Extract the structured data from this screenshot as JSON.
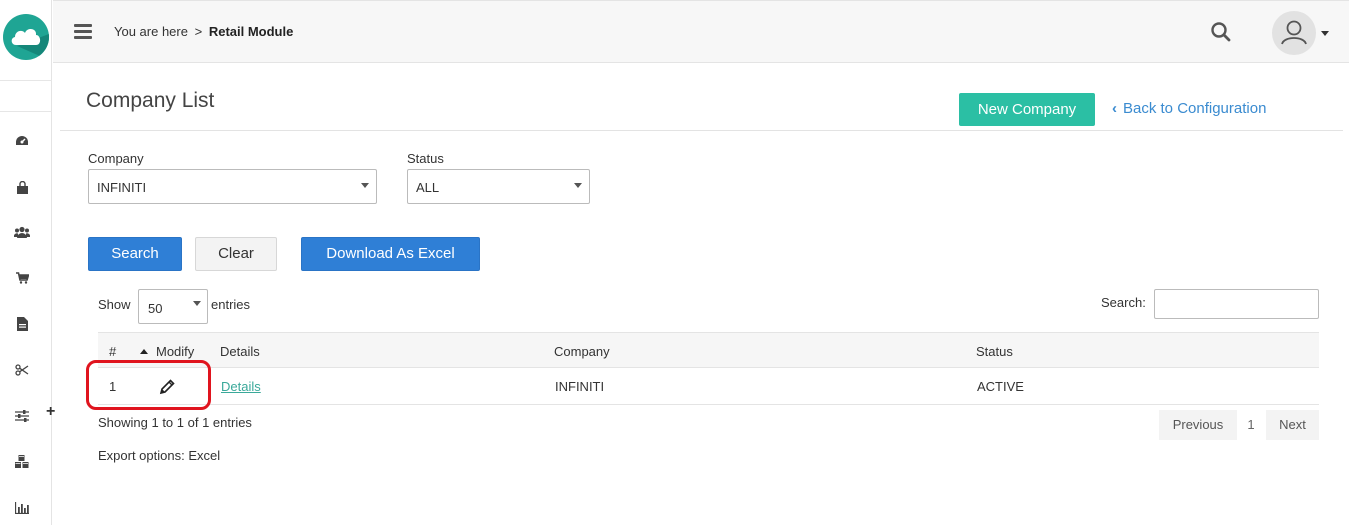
{
  "breadcrumb": {
    "prefix": "You are here",
    "separator": ">",
    "current": "Retail Module"
  },
  "page": {
    "title": "Company List"
  },
  "actions": {
    "new_company": "New Company",
    "back_to_config": "Back to Configuration"
  },
  "filters": {
    "company": {
      "label": "Company",
      "value": "INFINITI"
    },
    "status": {
      "label": "Status",
      "value": "ALL"
    }
  },
  "buttons": {
    "search": "Search",
    "clear": "Clear",
    "download_excel": "Download As Excel"
  },
  "table_controls": {
    "show_label": "Show",
    "page_size": "50",
    "entries_label": "entries",
    "search_label": "Search:",
    "search_value": ""
  },
  "table": {
    "headers": [
      "#",
      "Modify",
      "Details",
      "Company",
      "Status"
    ],
    "rows": [
      {
        "index": "1",
        "details": "Details",
        "company": "INFINITI",
        "status": "ACTIVE"
      }
    ]
  },
  "footer": {
    "info": "Showing 1 to 1 of 1 entries",
    "export": "Export options: Excel",
    "previous": "Previous",
    "page": "1",
    "next": "Next"
  },
  "sidebar": {
    "icons": [
      "dashboard-icon",
      "shopping-bag-icon",
      "users-icon",
      "cart-icon",
      "document-icon",
      "scissors-icon",
      "sliders-icon",
      "cubes-icon",
      "bar-chart-icon"
    ]
  },
  "colors": {
    "brand": "#1fa594",
    "primary": "#2f7fd6",
    "success": "#2bbfa4",
    "link": "#3a8bd0",
    "highlight": "#e0141e"
  }
}
